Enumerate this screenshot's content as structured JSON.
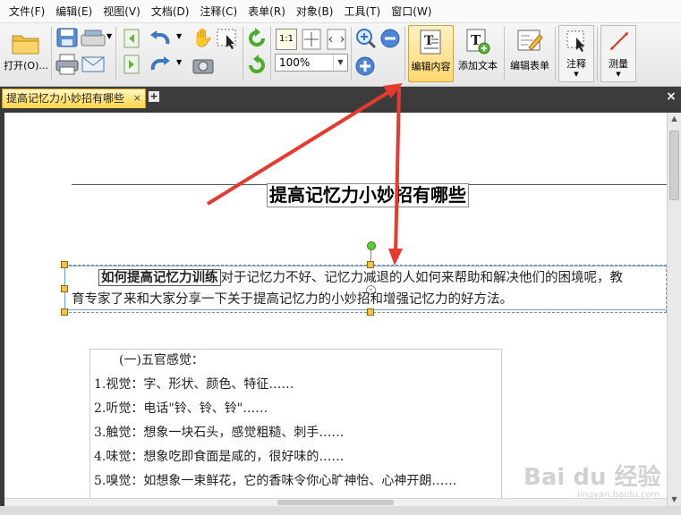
{
  "menu": [
    "文件(F)",
    "编辑(E)",
    "视图(V)",
    "文档(D)",
    "注释(C)",
    "表单(R)",
    "对象(B)",
    "工具(T)",
    "窗口(W)"
  ],
  "toolbar": {
    "open_label": "打开(O)...",
    "zoom_value": "100%",
    "actual_size_label": "1:1",
    "edit_content_label": "编辑内容",
    "add_text_label": "添加文本",
    "edit_form_label": "编辑表单",
    "annotate_label": "注释",
    "measure_label": "测量"
  },
  "tabs": [
    {
      "label": "提高记忆力小妙招有哪些",
      "close": "×"
    }
  ],
  "tab_add": "+",
  "tab_close_all": "×",
  "document": {
    "title": "提高记忆力小妙招有哪些",
    "para_lead": "如何提高记忆力训练",
    "para_line1": "对于记忆力不好、记忆力减退的人如何来帮助和解决他们的困境呢，教",
    "para_line2": "育专家了来和大家分享一下关于提高记忆力的小妙招和增强记忆力的好方法。",
    "list_heading": "(一)五官感觉：",
    "list": [
      "1.视觉：字、形状、颜色、特征……",
      "2.听觉：电话\"铃、铃、铃\"……",
      "3.触觉：想象一块石头，感觉粗糙、刺手……",
      "4.味觉：想象吃即食面是咸的，很好味的……",
      "5.嗅觉：如想象一束鲜花，它的香味令你心旷神怡、心神开朗……"
    ]
  },
  "watermark": "Bai du 经验",
  "watermark_sub": "jingyan.baidu.com",
  "colors": {
    "accent_tab": "#ffd54a",
    "arrow": "#e8392f",
    "selection": "#6fa3e8",
    "handle": "#f4c440"
  }
}
